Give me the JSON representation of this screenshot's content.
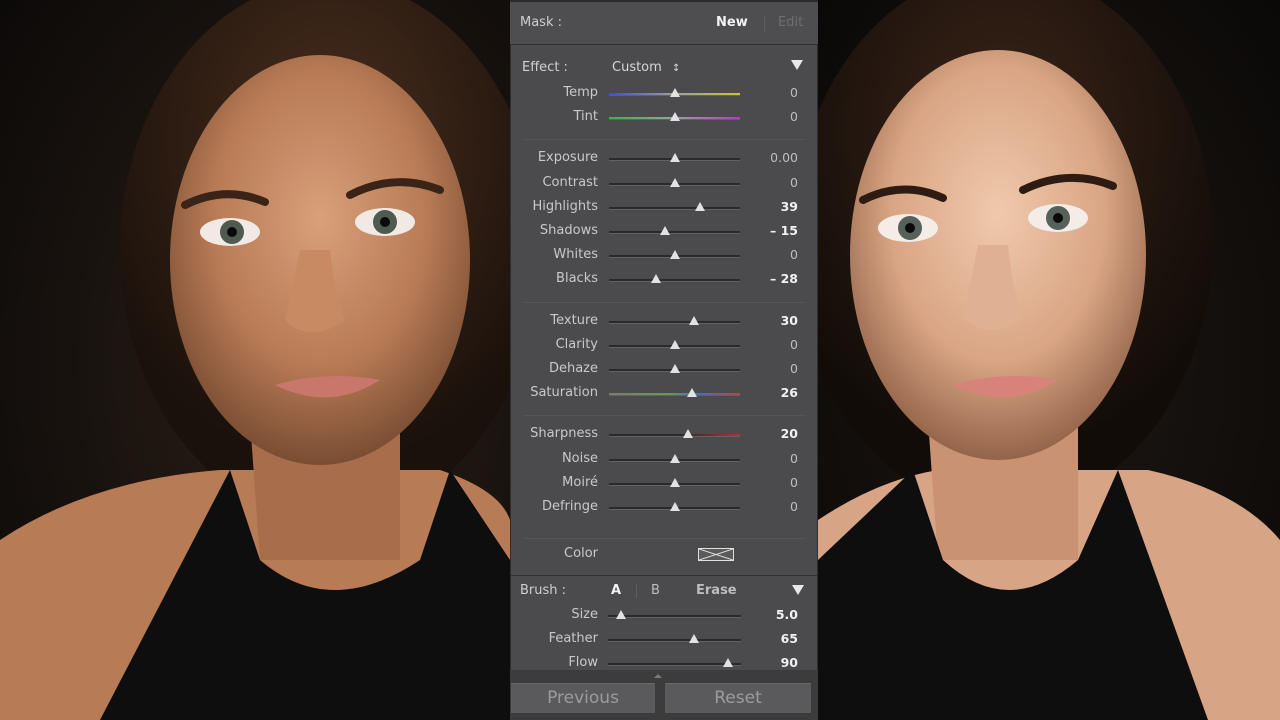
{
  "mask": {
    "label": "Mask :",
    "new_label": "New",
    "edit_label": "Edit"
  },
  "effect": {
    "label": "Effect :",
    "preset": "Custom",
    "preset_icon": "up-down-stepper-icon",
    "collapse_icon": "triangle-down-icon"
  },
  "groups": [
    [
      {
        "label": "Temp",
        "value": "0",
        "pos": 0.5,
        "track": "temp"
      },
      {
        "label": "Tint",
        "value": "0",
        "pos": 0.5,
        "track": "tint"
      }
    ],
    [
      {
        "label": "Exposure",
        "value": "0.00",
        "pos": 0.5
      },
      {
        "label": "Contrast",
        "value": "0",
        "pos": 0.5
      },
      {
        "label": "Highlights",
        "value": "39",
        "pos": 0.695
      },
      {
        "label": "Shadows",
        "value": "– 15",
        "pos": 0.425
      },
      {
        "label": "Whites",
        "value": "0",
        "pos": 0.5
      },
      {
        "label": "Blacks",
        "value": "– 28",
        "pos": 0.36
      }
    ],
    [
      {
        "label": "Texture",
        "value": "30",
        "pos": 0.65
      },
      {
        "label": "Clarity",
        "value": "0",
        "pos": 0.5
      },
      {
        "label": "Dehaze",
        "value": "0",
        "pos": 0.5
      },
      {
        "label": "Saturation",
        "value": "26",
        "pos": 0.63,
        "track": "saturation"
      }
    ],
    [
      {
        "label": "Sharpness",
        "value": "20",
        "pos": 0.6,
        "track": "sharpness"
      },
      {
        "label": "Noise",
        "value": "0",
        "pos": 0.5
      },
      {
        "label": "Moiré",
        "value": "0",
        "pos": 0.5
      },
      {
        "label": "Defringe",
        "value": "0",
        "pos": 0.5
      }
    ]
  ],
  "color": {
    "label": "Color",
    "swatch_icon": "no-color-swatch-icon"
  },
  "brush": {
    "label": "Brush :",
    "a_label": "A",
    "b_label": "B",
    "erase_label": "Erase",
    "collapse_icon": "triangle-down-icon",
    "sliders": [
      {
        "label": "Size",
        "value": "5.0",
        "pos": 0.1
      },
      {
        "label": "Feather",
        "value": "65",
        "pos": 0.65
      },
      {
        "label": "Flow",
        "value": "90",
        "pos": 0.9
      }
    ]
  },
  "buttons": {
    "previous": "Previous",
    "reset": "Reset"
  },
  "colors": {
    "panel": "#4b4b4d",
    "track": "#2a2a2b",
    "thumb": "#e2e2e2",
    "text": "#c9c9c9",
    "value_active": "#f1f1f1"
  }
}
